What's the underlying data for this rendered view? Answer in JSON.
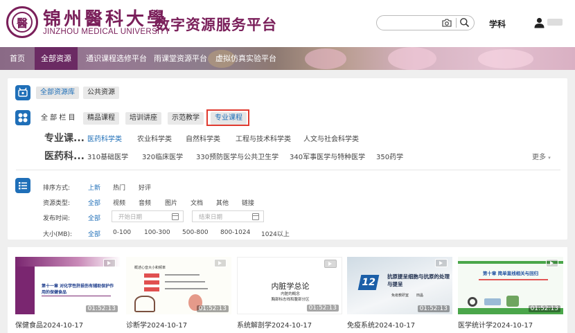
{
  "header": {
    "logo_cn": "锦州醫科大學",
    "logo_en": "JINZHOU MEDICAL UNIVERSITY",
    "platform_title": "数字资源服务平台",
    "search_placeholder": "",
    "subject_link": "学科"
  },
  "nav": {
    "items": [
      "首页",
      "全部资源",
      "通识课程选修平台",
      "雨课堂资源平台",
      "虚拟仿真实验平台"
    ],
    "active_index": 1
  },
  "filters": {
    "library_tabs": [
      "全部资源库",
      "公共资源"
    ],
    "column_label": "全 部 栏 目",
    "column_tabs": [
      "精品课程",
      "培训讲座",
      "示范教学",
      "专业课程"
    ],
    "subject_rows": [
      {
        "head": "专业课...",
        "items": [
          "医药科学类",
          "农业科学类",
          "自然科学类",
          "工程与技术科学类",
          "人文与社会科学类"
        ],
        "active": 0
      },
      {
        "head": "医药科...",
        "items": [
          "310基础医学",
          "320临床医学",
          "330预防医学与公共卫生学",
          "340军事医学与特种医学",
          "350药学"
        ]
      }
    ],
    "more_label": "更多",
    "sort": {
      "label": "排序方式:",
      "options": [
        "上新",
        "热门",
        "好评"
      ],
      "active": 0
    },
    "type": {
      "label": "资源类型:",
      "options": [
        "全部",
        "视频",
        "音频",
        "图片",
        "文档",
        "其他",
        "链接"
      ],
      "active": 0
    },
    "date": {
      "label": "发布时间:",
      "all": "全部",
      "start_placeholder": "开始日期",
      "end_placeholder": "结束日期"
    },
    "size": {
      "label": "大小(MB):",
      "options": [
        "全部",
        "0-100",
        "100-300",
        "500-800",
        "800-1024",
        "1024以上"
      ],
      "active": 0
    }
  },
  "cards": [
    {
      "title": "保健食品2024-10-17",
      "duration": "01:52:13",
      "slide_text": "第十一章 对化学性肝损伤有辅助保护作用的保健食品"
    },
    {
      "title": "诊断学2024-10-17",
      "duration": "01:52:13",
      "slide_text": "概述心音大小和频率"
    },
    {
      "title": "系统解剖学2024-10-17",
      "duration": "01:52:13",
      "slide_text": "内脏学总论",
      "slide_sub1": "内脏的概念",
      "slide_sub2": "胸部标志线和腹部分区"
    },
    {
      "title": "免疫系统2024-10-17",
      "duration": "01:52:13",
      "slide_num": "12",
      "slide_text": "抗原提呈细胞与抗原的处理与提呈",
      "slide_sub1": "免疫教研室",
      "slide_sub2": "田晶"
    },
    {
      "title": "医学统计学2024-10-17",
      "duration": "01:52:13",
      "slide_text": "第十章 简单直线相关与回归"
    }
  ],
  "colors": {
    "brand": "#7a1f5a",
    "nav_active": "#6b2a63",
    "accent": "#1f6fb8",
    "highlight": "#e03a2f"
  }
}
